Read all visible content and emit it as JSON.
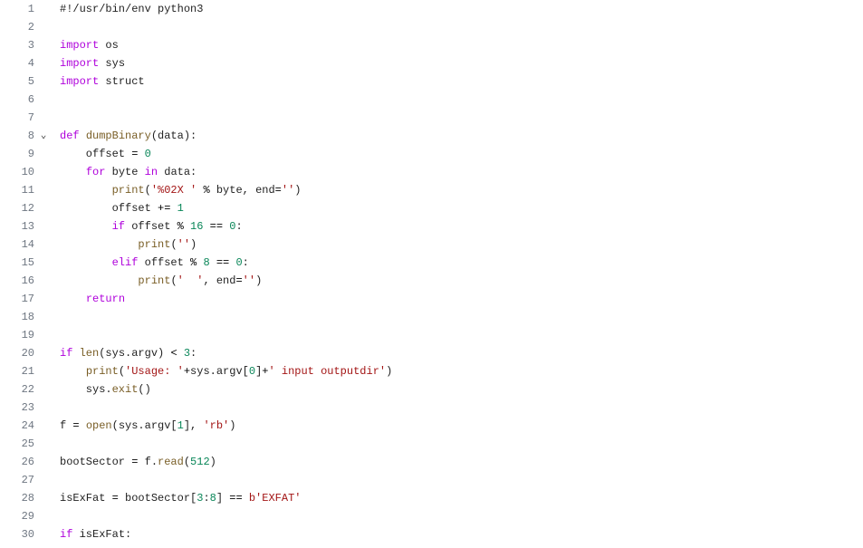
{
  "lines": [
    {
      "num": 1,
      "fold": "",
      "tokens": [
        {
          "c": "cmt",
          "t": "#!/usr/bin/env python3"
        }
      ]
    },
    {
      "num": 2,
      "fold": "",
      "tokens": []
    },
    {
      "num": 3,
      "fold": "",
      "tokens": [
        {
          "c": "kw",
          "t": "import"
        },
        {
          "c": "nm",
          "t": " os"
        }
      ]
    },
    {
      "num": 4,
      "fold": "",
      "tokens": [
        {
          "c": "kw",
          "t": "import"
        },
        {
          "c": "nm",
          "t": " sys"
        }
      ]
    },
    {
      "num": 5,
      "fold": "",
      "tokens": [
        {
          "c": "kw",
          "t": "import"
        },
        {
          "c": "nm",
          "t": " struct"
        }
      ]
    },
    {
      "num": 6,
      "fold": "",
      "tokens": []
    },
    {
      "num": 7,
      "fold": "",
      "tokens": []
    },
    {
      "num": 8,
      "fold": "v",
      "tokens": [
        {
          "c": "kw",
          "t": "def"
        },
        {
          "c": "nm",
          "t": " "
        },
        {
          "c": "fn",
          "t": "dumpBinary"
        },
        {
          "c": "nm",
          "t": "(data):"
        }
      ]
    },
    {
      "num": 9,
      "fold": "",
      "tokens": [
        {
          "c": "nm",
          "t": "    offset "
        },
        {
          "c": "op",
          "t": "="
        },
        {
          "c": "nm",
          "t": " "
        },
        {
          "c": "num",
          "t": "0"
        }
      ]
    },
    {
      "num": 10,
      "fold": "",
      "tokens": [
        {
          "c": "nm",
          "t": "    "
        },
        {
          "c": "kw",
          "t": "for"
        },
        {
          "c": "nm",
          "t": " byte "
        },
        {
          "c": "kw",
          "t": "in"
        },
        {
          "c": "nm",
          "t": " data:"
        }
      ]
    },
    {
      "num": 11,
      "fold": "",
      "tokens": [
        {
          "c": "nm",
          "t": "        "
        },
        {
          "c": "fn",
          "t": "print"
        },
        {
          "c": "nm",
          "t": "("
        },
        {
          "c": "str",
          "t": "'%02X '"
        },
        {
          "c": "nm",
          "t": " "
        },
        {
          "c": "op",
          "t": "%"
        },
        {
          "c": "nm",
          "t": " byte, end"
        },
        {
          "c": "op",
          "t": "="
        },
        {
          "c": "str",
          "t": "''"
        },
        {
          "c": "nm",
          "t": ")"
        }
      ]
    },
    {
      "num": 12,
      "fold": "",
      "tokens": [
        {
          "c": "nm",
          "t": "        offset "
        },
        {
          "c": "op",
          "t": "+="
        },
        {
          "c": "nm",
          "t": " "
        },
        {
          "c": "num",
          "t": "1"
        }
      ]
    },
    {
      "num": 13,
      "fold": "",
      "tokens": [
        {
          "c": "nm",
          "t": "        "
        },
        {
          "c": "kw",
          "t": "if"
        },
        {
          "c": "nm",
          "t": " offset "
        },
        {
          "c": "op",
          "t": "%"
        },
        {
          "c": "nm",
          "t": " "
        },
        {
          "c": "num",
          "t": "16"
        },
        {
          "c": "nm",
          "t": " "
        },
        {
          "c": "op",
          "t": "=="
        },
        {
          "c": "nm",
          "t": " "
        },
        {
          "c": "num",
          "t": "0"
        },
        {
          "c": "nm",
          "t": ":"
        }
      ]
    },
    {
      "num": 14,
      "fold": "",
      "tokens": [
        {
          "c": "nm",
          "t": "            "
        },
        {
          "c": "fn",
          "t": "print"
        },
        {
          "c": "nm",
          "t": "("
        },
        {
          "c": "str",
          "t": "''"
        },
        {
          "c": "nm",
          "t": ")"
        }
      ]
    },
    {
      "num": 15,
      "fold": "",
      "tokens": [
        {
          "c": "nm",
          "t": "        "
        },
        {
          "c": "kw",
          "t": "elif"
        },
        {
          "c": "nm",
          "t": " offset "
        },
        {
          "c": "op",
          "t": "%"
        },
        {
          "c": "nm",
          "t": " "
        },
        {
          "c": "num",
          "t": "8"
        },
        {
          "c": "nm",
          "t": " "
        },
        {
          "c": "op",
          "t": "=="
        },
        {
          "c": "nm",
          "t": " "
        },
        {
          "c": "num",
          "t": "0"
        },
        {
          "c": "nm",
          "t": ":"
        }
      ]
    },
    {
      "num": 16,
      "fold": "",
      "tokens": [
        {
          "c": "nm",
          "t": "            "
        },
        {
          "c": "fn",
          "t": "print"
        },
        {
          "c": "nm",
          "t": "("
        },
        {
          "c": "str",
          "t": "'  '"
        },
        {
          "c": "nm",
          "t": ", end"
        },
        {
          "c": "op",
          "t": "="
        },
        {
          "c": "str",
          "t": "''"
        },
        {
          "c": "nm",
          "t": ")"
        }
      ]
    },
    {
      "num": 17,
      "fold": "",
      "tokens": [
        {
          "c": "nm",
          "t": "    "
        },
        {
          "c": "kw",
          "t": "return"
        }
      ]
    },
    {
      "num": 18,
      "fold": "",
      "tokens": []
    },
    {
      "num": 19,
      "fold": "",
      "tokens": []
    },
    {
      "num": 20,
      "fold": "",
      "tokens": [
        {
          "c": "kw",
          "t": "if"
        },
        {
          "c": "nm",
          "t": " "
        },
        {
          "c": "fn",
          "t": "len"
        },
        {
          "c": "nm",
          "t": "(sys.argv) "
        },
        {
          "c": "op",
          "t": "<"
        },
        {
          "c": "nm",
          "t": " "
        },
        {
          "c": "num",
          "t": "3"
        },
        {
          "c": "nm",
          "t": ":"
        }
      ]
    },
    {
      "num": 21,
      "fold": "",
      "tokens": [
        {
          "c": "nm",
          "t": "    "
        },
        {
          "c": "fn",
          "t": "print"
        },
        {
          "c": "nm",
          "t": "("
        },
        {
          "c": "str",
          "t": "'Usage: '"
        },
        {
          "c": "op",
          "t": "+"
        },
        {
          "c": "nm",
          "t": "sys.argv["
        },
        {
          "c": "num",
          "t": "0"
        },
        {
          "c": "nm",
          "t": "]"
        },
        {
          "c": "op",
          "t": "+"
        },
        {
          "c": "str",
          "t": "' input outputdir'"
        },
        {
          "c": "nm",
          "t": ")"
        }
      ]
    },
    {
      "num": 22,
      "fold": "",
      "tokens": [
        {
          "c": "nm",
          "t": "    sys."
        },
        {
          "c": "fn",
          "t": "exit"
        },
        {
          "c": "nm",
          "t": "()"
        }
      ]
    },
    {
      "num": 23,
      "fold": "",
      "tokens": []
    },
    {
      "num": 24,
      "fold": "",
      "tokens": [
        {
          "c": "nm",
          "t": "f "
        },
        {
          "c": "op",
          "t": "="
        },
        {
          "c": "nm",
          "t": " "
        },
        {
          "c": "fn",
          "t": "open"
        },
        {
          "c": "nm",
          "t": "(sys.argv["
        },
        {
          "c": "num",
          "t": "1"
        },
        {
          "c": "nm",
          "t": "], "
        },
        {
          "c": "str",
          "t": "'rb'"
        },
        {
          "c": "nm",
          "t": ")"
        }
      ]
    },
    {
      "num": 25,
      "fold": "",
      "tokens": []
    },
    {
      "num": 26,
      "fold": "",
      "tokens": [
        {
          "c": "nm",
          "t": "bootSector "
        },
        {
          "c": "op",
          "t": "="
        },
        {
          "c": "nm",
          "t": " f."
        },
        {
          "c": "fn",
          "t": "read"
        },
        {
          "c": "nm",
          "t": "("
        },
        {
          "c": "num",
          "t": "512"
        },
        {
          "c": "nm",
          "t": ")"
        }
      ]
    },
    {
      "num": 27,
      "fold": "",
      "tokens": []
    },
    {
      "num": 28,
      "fold": "",
      "tokens": [
        {
          "c": "nm",
          "t": "isExFat "
        },
        {
          "c": "op",
          "t": "="
        },
        {
          "c": "nm",
          "t": " bootSector["
        },
        {
          "c": "num",
          "t": "3"
        },
        {
          "c": "nm",
          "t": ":"
        },
        {
          "c": "num",
          "t": "8"
        },
        {
          "c": "nm",
          "t": "] "
        },
        {
          "c": "op",
          "t": "=="
        },
        {
          "c": "nm",
          "t": " "
        },
        {
          "c": "str",
          "t": "b'EXFAT'"
        }
      ]
    },
    {
      "num": 29,
      "fold": "",
      "tokens": []
    },
    {
      "num": 30,
      "fold": "",
      "tokens": [
        {
          "c": "kw",
          "t": "if"
        },
        {
          "c": "nm",
          "t": " isExFat:"
        }
      ]
    }
  ],
  "fold_glyph": "⌄"
}
